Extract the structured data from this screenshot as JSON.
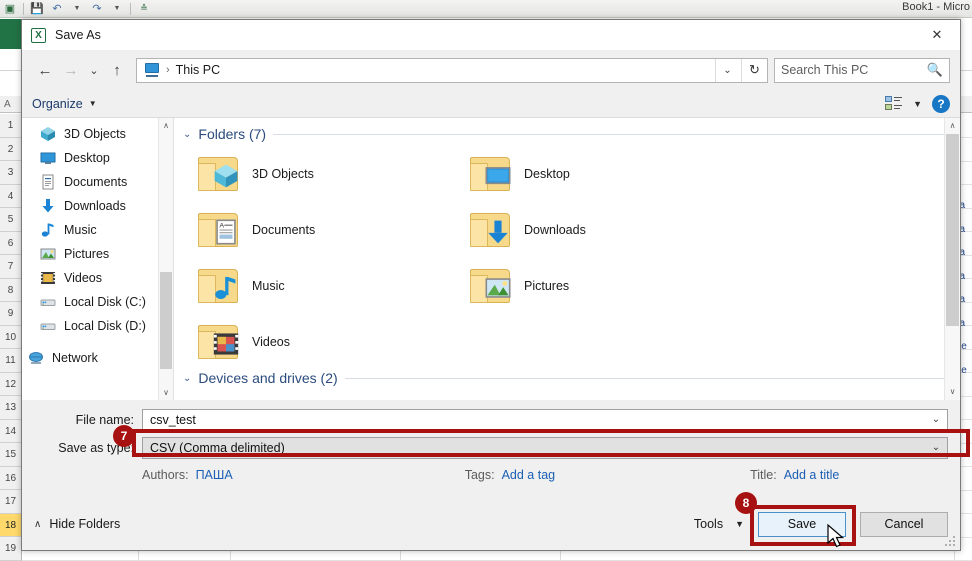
{
  "excel": {
    "window_title": "Book1 - Micro",
    "quick_access": [
      "excel-icon",
      "save-icon",
      "undo-icon",
      "redo-icon",
      "customize-icon"
    ],
    "column_header_partial": "A",
    "row_numbers": [
      "1",
      "2",
      "3",
      "4",
      "5",
      "6",
      "7",
      "8",
      "9",
      "10",
      "11",
      "12",
      "13",
      "14",
      "15",
      "16",
      "17",
      "18",
      "19"
    ],
    "selected_row": "18",
    "right_cells": [
      "pa",
      "pa",
      "pa",
      "pa",
      "pa",
      "pa",
      "De",
      "De"
    ]
  },
  "dialog": {
    "title": "Save As",
    "icon": "excel-icon",
    "close_label": "✕",
    "nav": {
      "back_icon": "arrow-left-icon",
      "forward_icon": "arrow-right-icon",
      "recent_icon": "chevron-down-icon",
      "up_icon": "arrow-up-icon",
      "breadcrumb": "This PC",
      "breadcrumb_icon": "this-pc-icon",
      "separator": "›",
      "dropdown_icon": "chevron-down-icon",
      "refresh_icon": "refresh-icon"
    },
    "search": {
      "placeholder": "Search This PC",
      "icon": "search-icon"
    },
    "toolbar": {
      "organize_label": "Organize",
      "organize_caret": "▼",
      "view_icon": "view-layout-icon",
      "view_caret": "▼",
      "help_label": "?"
    },
    "nav_pane": {
      "items": [
        {
          "label": "3D Objects",
          "icon": "3d-objects-icon"
        },
        {
          "label": "Desktop",
          "icon": "desktop-icon"
        },
        {
          "label": "Documents",
          "icon": "documents-icon"
        },
        {
          "label": "Downloads",
          "icon": "downloads-icon"
        },
        {
          "label": "Music",
          "icon": "music-icon"
        },
        {
          "label": "Pictures",
          "icon": "pictures-icon"
        },
        {
          "label": "Videos",
          "icon": "videos-icon"
        },
        {
          "label": "Local Disk (C:)",
          "icon": "local-disk-icon"
        },
        {
          "label": "Local Disk (D:)",
          "icon": "local-disk-icon"
        },
        {
          "label": "Network",
          "icon": "network-icon"
        }
      ],
      "scroll_up": "∧",
      "scroll_down": "∨"
    },
    "file_pane": {
      "groups": [
        {
          "label": "Folders (7)",
          "chevron": "⌄"
        },
        {
          "label": "Devices and drives (2)",
          "chevron": "⌄"
        }
      ],
      "folders": [
        {
          "label": "3D Objects",
          "icon": "3d-objects-icon"
        },
        {
          "label": "Desktop",
          "icon": "desktop-icon"
        },
        {
          "label": "Documents",
          "icon": "documents-icon"
        },
        {
          "label": "Downloads",
          "icon": "downloads-icon"
        },
        {
          "label": "Music",
          "icon": "music-icon"
        },
        {
          "label": "Pictures",
          "icon": "pictures-icon"
        },
        {
          "label": "Videos",
          "icon": "videos-icon"
        }
      ],
      "scroll_up": "∧",
      "scroll_down": "∨"
    },
    "form": {
      "file_name_label": "File name:",
      "file_name_value": "csv_test",
      "save_as_type_label": "Save as type:",
      "save_as_type_value": "CSV (Comma delimited)",
      "combo_chevron": "⌄",
      "authors_label": "Authors:",
      "authors_value": "ПАША",
      "tags_label": "Tags:",
      "tags_value": "Add a tag",
      "title_label": "Title:",
      "title_value": "Add a title"
    },
    "footer": {
      "hide_folders_label": "Hide Folders",
      "hide_folders_chevron": "∧",
      "tools_label": "Tools",
      "tools_caret": "▼",
      "save_label": "Save",
      "cancel_label": "Cancel"
    }
  },
  "annotations": {
    "accent_color": "#a81111",
    "badges": [
      {
        "number": "7",
        "target": "save-as-type-field"
      },
      {
        "number": "8",
        "target": "save-button"
      }
    ]
  }
}
